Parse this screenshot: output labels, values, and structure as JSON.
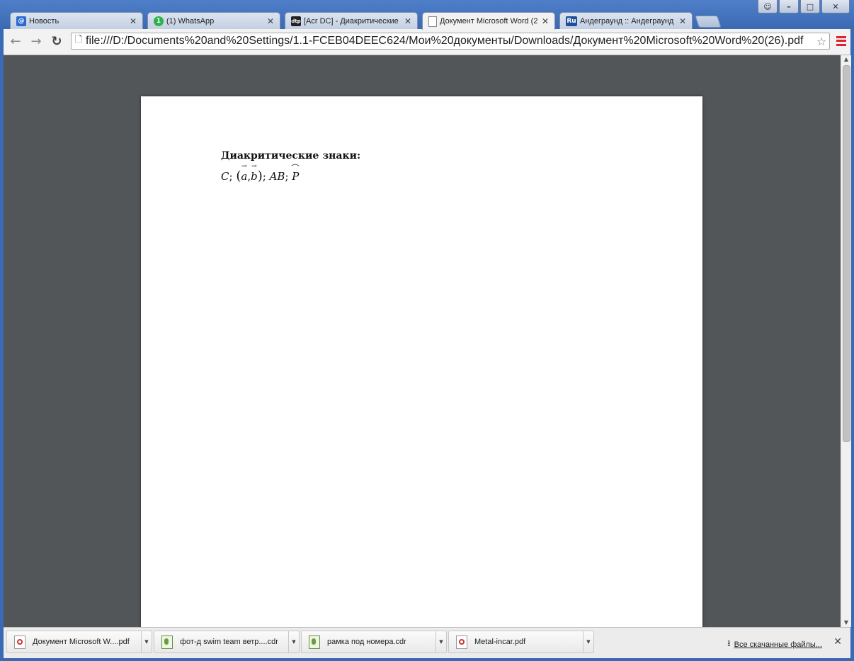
{
  "tabs": [
    {
      "label": "Новость",
      "favicon": "mail-at-icon",
      "favicon_color": "#2a6bd1",
      "active": false
    },
    {
      "label": "(1) WhatsApp",
      "favicon": "whatsapp-badge-icon",
      "favicon_color": "#2bb24c",
      "favicon_text": "1",
      "active": false
    },
    {
      "label": "[Acr DC] - Диакритические",
      "favicon": "dtp-icon",
      "favicon_color": "#222222",
      "favicon_text": "dtp",
      "active": false
    },
    {
      "label": "Документ Microsoft Word (2",
      "favicon": "document-icon",
      "favicon_color": "#ffffff",
      "active": true
    },
    {
      "label": "Андеграунд :: Андеграунд",
      "favicon": "ru-icon",
      "favicon_color": "#1d4f9a",
      "favicon_text": "Ru",
      "active": false
    }
  ],
  "tab_close_glyph": "✕",
  "toolbar": {
    "back_glyph": "←",
    "forward_glyph": "→",
    "reload_glyph": "↻",
    "url": "file:///D:/Documents%20and%20Settings/1.1-FCEB04DEEC624/Мои%20документы/Downloads/Документ%20Microsoft%20Word%20(26).pdf",
    "star_glyph": "☆"
  },
  "document": {
    "heading": "Диакритические знаки:",
    "formula": {
      "c": "C",
      "sep1": ";",
      "open": "(",
      "a": "a",
      "comma": ",",
      "b": "b",
      "close": ")",
      "sep2": ";",
      "ab": "AB",
      "sep3": ";",
      "p": "P"
    }
  },
  "downloads": [
    {
      "name": "Документ Microsoft W....pdf",
      "type": "pdf"
    },
    {
      "name": "фот-д swim team ветр....cdr",
      "type": "cdr"
    },
    {
      "name": "рамка под номера.cdr",
      "type": "cdr"
    },
    {
      "name": "Metal-incar.pdf",
      "type": "pdf"
    }
  ],
  "shelf": {
    "show_all_label": "Все скачанные файлы...",
    "close_glyph": "✕"
  }
}
